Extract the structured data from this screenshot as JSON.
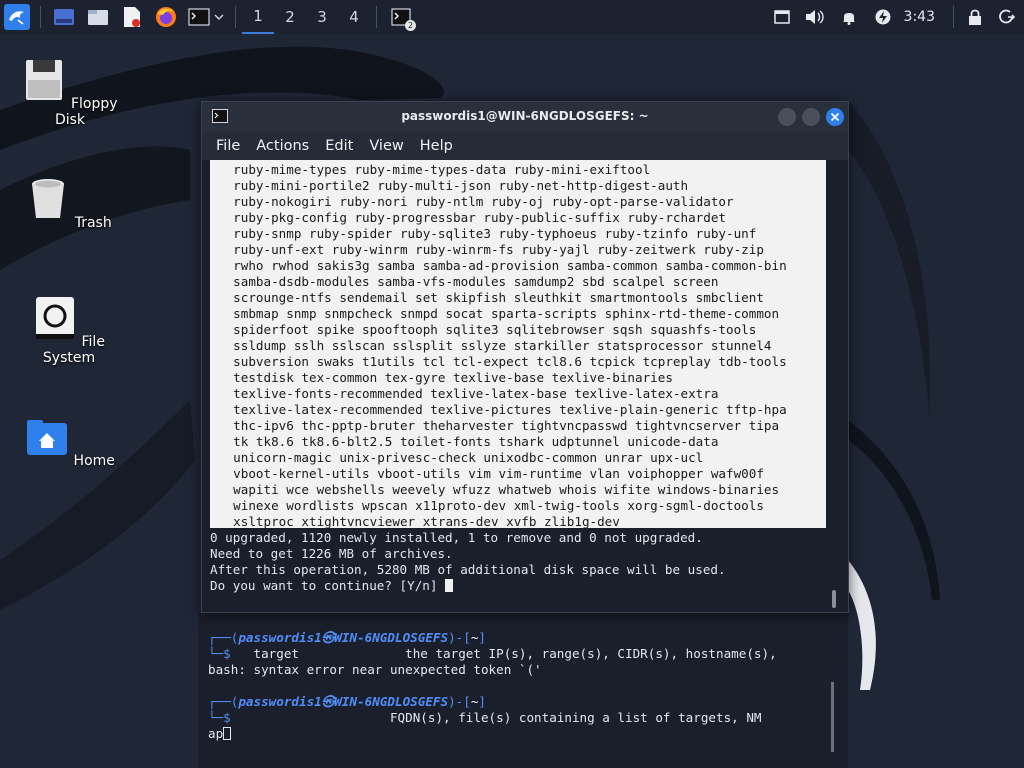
{
  "panel": {
    "workspaces": [
      "1",
      "2",
      "3",
      "4"
    ],
    "task_badge": "2",
    "clock": "3:43"
  },
  "desktop": {
    "icons": [
      {
        "label": "Floppy Disk"
      },
      {
        "label": "Trash"
      },
      {
        "label": "File System"
      },
      {
        "label": "Home"
      }
    ]
  },
  "terminal": {
    "title": "passwordis1@WIN-6NGDLOSGEFS: ~",
    "menu": [
      "File",
      "Actions",
      "Edit",
      "View",
      "Help"
    ],
    "selected_lines": [
      "  ruby-mime-types ruby-mime-types-data ruby-mini-exiftool",
      "  ruby-mini-portile2 ruby-multi-json ruby-net-http-digest-auth",
      "  ruby-nokogiri ruby-nori ruby-ntlm ruby-oj ruby-opt-parse-validator",
      "  ruby-pkg-config ruby-progressbar ruby-public-suffix ruby-rchardet",
      "  ruby-snmp ruby-spider ruby-sqlite3 ruby-typhoeus ruby-tzinfo ruby-unf",
      "  ruby-unf-ext ruby-winrm ruby-winrm-fs ruby-yajl ruby-zeitwerk ruby-zip",
      "  rwho rwhod sakis3g samba samba-ad-provision samba-common samba-common-bin",
      "  samba-dsdb-modules samba-vfs-modules samdump2 sbd scalpel screen",
      "  scrounge-ntfs sendemail set skipfish sleuthkit smartmontools smbclient",
      "  smbmap snmp snmpcheck snmpd socat sparta-scripts sphinx-rtd-theme-common",
      "  spiderfoot spike spooftooph sqlite3 sqlitebrowser sqsh squashfs-tools",
      "  ssldump sslh sslscan sslsplit sslyze starkiller statsprocessor stunnel4",
      "  subversion swaks t1utils tcl tcl-expect tcl8.6 tcpick tcpreplay tdb-tools",
      "  testdisk tex-common tex-gyre texlive-base texlive-binaries",
      "  texlive-fonts-recommended texlive-latex-base texlive-latex-extra",
      "  texlive-latex-recommended texlive-pictures texlive-plain-generic tftp-hpa",
      "  thc-ipv6 thc-pptp-bruter theharvester tightvncpasswd tightvncserver tipa",
      "  tk tk8.6 tk8.6-blt2.5 toilet-fonts tshark udptunnel unicode-data",
      "  unicorn-magic unix-privesc-check unixodbc-common unrar upx-ucl",
      "  vboot-kernel-utils vboot-utils vim vim-runtime vlan voiphopper wafw00f",
      "  wapiti wce webshells weevely wfuzz whatweb whois wifite windows-binaries",
      "  winexe wordlists wpscan x11proto-dev xml-twig-tools xorg-sgml-doctools",
      "  xsltproc xtightvncviewer xtrans-dev xvfb zlib1g-dev"
    ],
    "summary_lines": [
      "0 upgraded, 1120 newly installed, 1 to remove and 0 not upgraded.",
      "Need to get 1226 MB of archives.",
      "After this operation, 5280 MB of additional disk space will be used."
    ],
    "prompt": "Do you want to continue? [Y/n] "
  },
  "back_terminal": {
    "user_host": "passwordis1㉿WIN-6NGDLOSGEFS",
    "cwd": "~",
    "line1_rest": "   target              the target IP(s), range(s), CIDR(s), hostname(s),",
    "line2": "bash: syntax error near unexpected token `('",
    "line3_rest": "                     FQDN(s), file(s) containing a list of targets, NM",
    "line4": "ap"
  }
}
